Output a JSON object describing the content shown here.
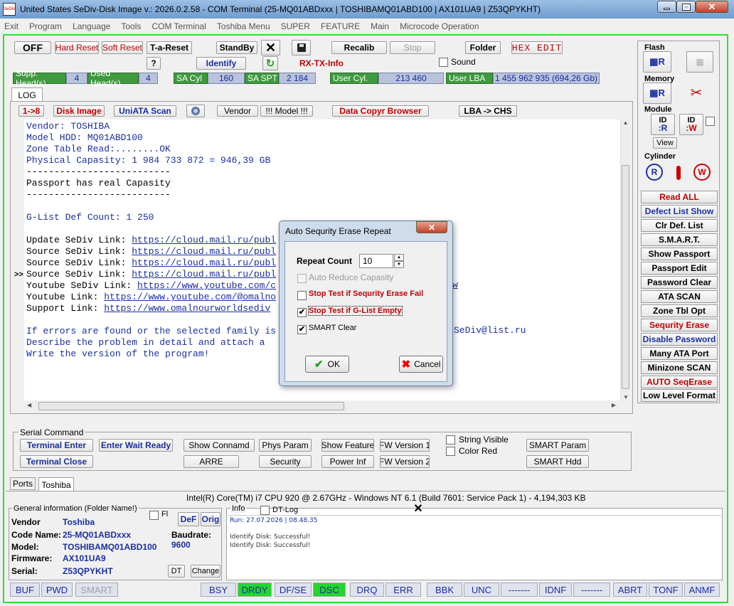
{
  "window": {
    "title": "United States  SeDiv-Disk Image v.: 2026.0.2.58 - COM Terminal  (25-MQ01ABDxxx | TOSHIBAMQ01ABD100 | AX101UA9 | Z53QPYKHT)",
    "logo": "SeDiv"
  },
  "menu": [
    "Exit",
    "Program",
    "Language",
    "Tools",
    "COM Terminal",
    "Toshiba Menu",
    "SUPER",
    "FEATURE",
    "Main",
    "Microcode Operation"
  ],
  "toolbar": {
    "off": "OFF",
    "hard_reset": "Hard Reset",
    "soft_reset": "Soft Reset",
    "t_a_reset": "T-a-Reset",
    "standby": "StandBy",
    "recalib": "Recalib",
    "stop": "Stop",
    "folder": "Folder",
    "hex_edit": "HEX EDIT",
    "help": "?",
    "identify": "Identify",
    "rx_tx": "RX-TX-Info",
    "sound": "Sound"
  },
  "params": {
    "supp_heads_label": "Supp. Head(s)",
    "supp_heads": "4",
    "used_heads_label": "Used Head(s)",
    "used_heads": "4",
    "sa_cyl_label": "SA Cyl",
    "sa_cyl": "160",
    "sa_spt_label": "SA SPT",
    "sa_spt": "2 184",
    "user_cyl_label": "User Cyl.",
    "user_cyl": "213 460",
    "user_lba_label": "User LBA",
    "user_lba": "1 455 962 935  (694,26 Gb)"
  },
  "log_tab": "LOG",
  "subtoolbar": {
    "b18": "1->8",
    "disk_image": "Disk Image",
    "uniata": "UniATA Scan",
    "vendor": "Vendor",
    "model": "!!! Model !!!",
    "data_copyr": "Data Copyr Browser",
    "lba_chs": "LBA -> CHS"
  },
  "log_lines": [
    {
      "t": "Vendor: TOSHIBA",
      "c": "blue"
    },
    {
      "t": "Model HDD: MQ01ABD100",
      "c": "blue"
    },
    {
      "t": "Zone Table Read:........OK",
      "c": "blue"
    },
    {
      "t": "Physical Capasity: 1 984 733 872 = 946,39 GB",
      "c": "blue"
    },
    {
      "t": "--------------------------",
      "c": "dark"
    },
    {
      "t": "Passport has real Capasity",
      "c": "dark"
    },
    {
      "t": "--------------------------",
      "c": "dark"
    },
    {
      "t": "",
      "c": "dark"
    },
    {
      "t": "G-List Def Count: 1 250",
      "c": "blue"
    },
    {
      "t": "",
      "c": "dark"
    },
    {
      "t": "Update SeDiv Link: https://cloud.mail.ru/publ",
      "c": "dark"
    },
    {
      "t": "Source SeDiv Link: https://cloud.mail.ru/publ",
      "c": "dark"
    },
    {
      "t": "Source SeDiv Link: https://cloud.mail.ru/publ",
      "c": "dark"
    },
    {
      "t": "Source SeDiv Link: https://cloud.mail.ru/publ",
      "c": "dark"
    },
    {
      "t": "Youtube SeDiv Link: https://www.youtube.com/c",
      "c": "dark"
    },
    {
      "t": "Youtube Link: https://www.youtube.com/@omalno",
      "c": "dark"
    },
    {
      "t": "Support Link: https://www.omalnourworldsediv",
      "c": "dark"
    },
    {
      "t": "",
      "c": "dark"
    },
    {
      "t": "If errors are found or the selected family is",
      "c": "blue"
    },
    {
      "t": "Describe the problem in detail and attach a",
      "c": "blue"
    },
    {
      "t": "Write the version of the program!",
      "c": "blue"
    }
  ],
  "log_right": {
    "w": "w",
    "email": "SeDiv@list.ru"
  },
  "side": {
    "flash": "Flash",
    "memory": "Memory",
    "module": "Module",
    "view": "View",
    "cylinder": "Cylinder",
    "id_r": "ID",
    "id_w": "ID"
  },
  "right_buttons": [
    {
      "label": "Read ALL",
      "cls": "red"
    },
    {
      "label": "Defect List Show",
      "cls": "blue"
    },
    {
      "label": "Clr Def. List",
      "cls": "dark"
    },
    {
      "label": "S.M.A.R.T.",
      "cls": "dark"
    },
    {
      "label": "Show Passport",
      "cls": "dark"
    },
    {
      "label": "Passport Edit",
      "cls": "dark"
    },
    {
      "label": "Password Clear",
      "cls": "dark"
    },
    {
      "label": "ATA SCAN",
      "cls": "dark"
    },
    {
      "label": "Zone Tbl Opt",
      "cls": "dark"
    },
    {
      "label": "Sequrity Erase",
      "cls": "red"
    },
    {
      "label": "Disable Password",
      "cls": "blue"
    },
    {
      "label": "Many ATA Port",
      "cls": "dark"
    },
    {
      "label": "Minizone SCAN",
      "cls": "dark"
    },
    {
      "label": "AUTO SeqErase",
      "cls": "red"
    },
    {
      "label": "Low Level Format",
      "cls": "dark"
    }
  ],
  "serial": {
    "group": "Serial Command",
    "terminal_enter": "Terminal Enter",
    "enter_wait": "Enter Wait Ready",
    "show_command": "Show Connamd",
    "phys_param": "Phys Param",
    "show_feature": "Show Feature",
    "fw1": "FW Version 1",
    "string_visible": "String Visible",
    "smart_param": "SMART Param",
    "terminal_close": "Terminal Close",
    "arre": "ARRE",
    "security": "Security",
    "power_inf": "Power Inf",
    "fw2": "FW Version 2",
    "color_red": "Color Red",
    "smart_hdd": "SMART Hdd"
  },
  "bottom_tabs": [
    "Ports",
    "Toshiba"
  ],
  "cpu_info": "Intel(R) Core(TM) i7 CPU 920  @ 2.67GHz - Windows NT 6.1 (Build 7601: Service Pack 1) - 4,194,303 KB",
  "general": {
    "title": "General information (Folder Name!)",
    "fl": "Fl",
    "def": "DeF",
    "orig": "Orig",
    "vendor_l": "Vendor",
    "vendor": "Toshiba",
    "code_l": "Code Name:",
    "code": "25-MQ01ABDxxx",
    "model_l": "Model:",
    "model": "TOSHIBAMQ01ABD100",
    "fw_l": "Firmware:",
    "fw": "AX101UA9",
    "serial_l": "Serial:",
    "serial": "Z53QPYKHT",
    "baud_l": "Baudrate:",
    "baud": "9600",
    "dt": "DT",
    "change": "Change"
  },
  "info": {
    "title": "Info",
    "dt_log": "DT-Log",
    "lines": [
      "Run: 27.07.2026 | 08.48.35",
      "",
      "Identify Disk: Successful!",
      "Identify Disk: Successful!"
    ]
  },
  "status": [
    "BUF",
    "PWD",
    "SMART",
    "BSY",
    "DRDY",
    "DF/SE",
    "DSC",
    "DRQ",
    "ERR",
    "BBK",
    "UNC",
    "-------",
    "IDNF",
    "-------",
    "ABRT",
    "TONF",
    "ANMF"
  ],
  "dialog": {
    "title": "Auto Sequrity Erase Repeat",
    "repeat_label": "Repeat Count",
    "repeat_value": "10",
    "auto_reduce": "Auto Reduce Capasity",
    "stop_fail": "Stop Test if Sequrity Erase Fail",
    "stop_glist": "Stop Test if G-List Empty",
    "smart_clear": "SMART Clear",
    "ok": "OK",
    "cancel": "Cancel",
    "checked": [
      false,
      false,
      true,
      true
    ]
  },
  "colors": {
    "accent_green": "#3d9a3d",
    "red": "#c00000",
    "blue": "#1a2f9e",
    "status_green": "#23d62b"
  }
}
